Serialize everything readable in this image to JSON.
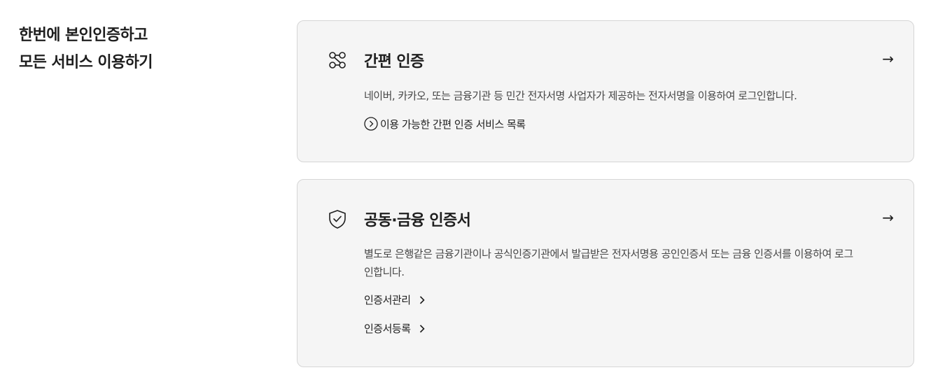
{
  "heading": {
    "line1": "한번에 본인인증하고",
    "line2": "모든 서비스 이용하기"
  },
  "cards": [
    {
      "icon": "easy-auth-icon",
      "title": "간편 인증",
      "arrow": "→",
      "description": "네이버, 카카오, 또는 금융기관 등 민간 전자서명 사업자가 제공하는 전자서명을 이용하여 로그인합니다.",
      "links": [
        {
          "label": "이용 가능한 간편 인증 서비스 목록",
          "icon": "circle-chevron-right-icon"
        }
      ]
    },
    {
      "icon": "shield-check-icon",
      "title": "공동·금융 인증서",
      "arrow": "→",
      "description": "별도로 은행같은 금융기관이나 공식인증기관에서 발급받은 전자서명용 공인인증서 또는 금융 인증서를 이용하여 로그인합니다.",
      "links": [
        {
          "label": "인증서관리",
          "icon": "chevron-right-icon"
        },
        {
          "label": "인증서등록",
          "icon": "chevron-right-icon"
        }
      ]
    }
  ],
  "colors": {
    "card_bg": "#f5f5f5",
    "card_border": "#d6d6d6",
    "text": "#1e1e1e",
    "desc_text": "#464646"
  }
}
